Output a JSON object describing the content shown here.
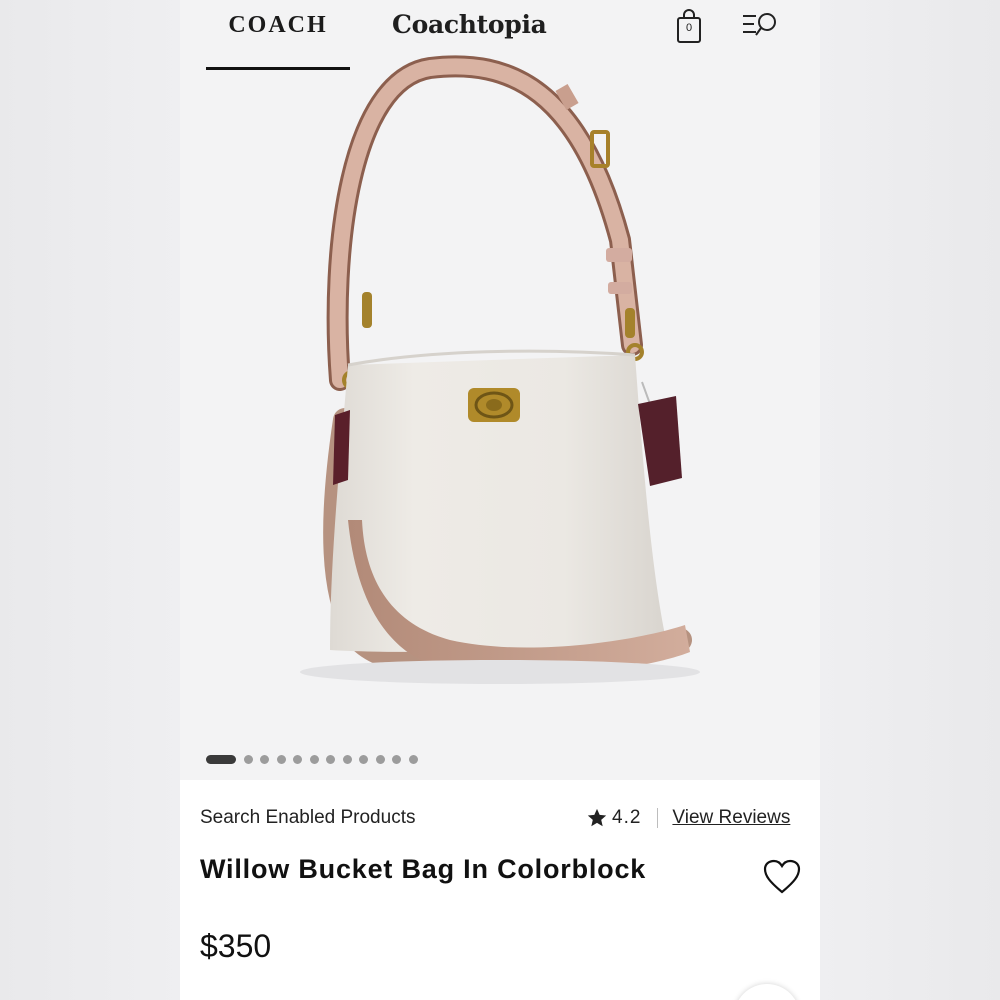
{
  "header": {
    "tabs": [
      {
        "label": "COACH",
        "active": true
      },
      {
        "label": "Coachtopia",
        "active": false
      }
    ],
    "bag_count": "0",
    "icons": [
      "shopping-bag-icon",
      "menu-search-icon"
    ]
  },
  "gallery": {
    "total_images": 12,
    "active_index": 0
  },
  "product": {
    "category_label": "Search Enabled Products",
    "rating": "4.2",
    "reviews_link": "View Reviews",
    "title": "Willow Bucket Bag In Colorblock",
    "price": "$350"
  },
  "colors": {
    "accent": "#111111",
    "background": "#f3f3f4",
    "card": "#ffffff"
  }
}
